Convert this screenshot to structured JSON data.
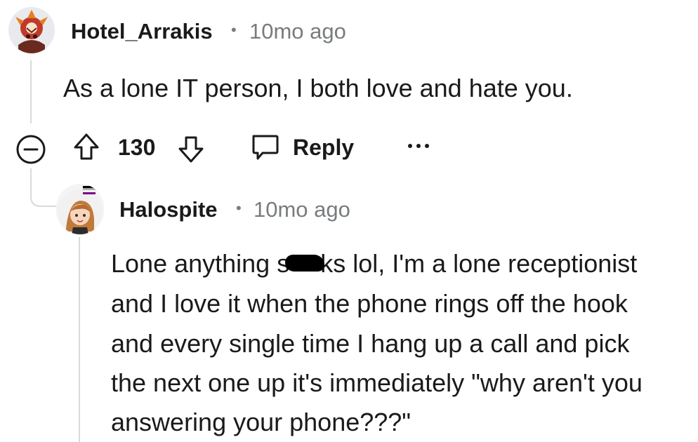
{
  "colors": {
    "text_primary": "#1a1a1b",
    "text_meta": "#787c7e",
    "thread_line": "#d9dadb",
    "redaction": "#000000"
  },
  "comment": {
    "username": "Hotel_Arrakis",
    "separator": "•",
    "timestamp": "10mo ago",
    "body": "As a lone IT person, I both love and hate you.",
    "avatar_icon": "demogorgon-avatar-icon",
    "actions": {
      "collapse_icon": "collapse-minus-icon",
      "upvote_icon": "upvote-arrow-icon",
      "vote_count": "130",
      "downvote_icon": "downvote-arrow-icon",
      "reply_icon": "speech-bubble-icon",
      "reply_label": "Reply",
      "more_icon": "more-dots-icon",
      "more_label": "•••"
    }
  },
  "reply": {
    "username": "Halospite",
    "separator": "•",
    "timestamp": "10mo ago",
    "avatar_icon": "anime-avatar-icon",
    "body_lines": {
      "line1_before": "Lone anything s",
      "line1_after": "ks lol, I'm a lone receptionist",
      "line2": "and I love it when the phone rings off the hook",
      "line3": "and every single time I hang up a call and pick",
      "line4": "the next one up it's immediately \"why aren't you",
      "line5": "answering your phone???\""
    }
  }
}
